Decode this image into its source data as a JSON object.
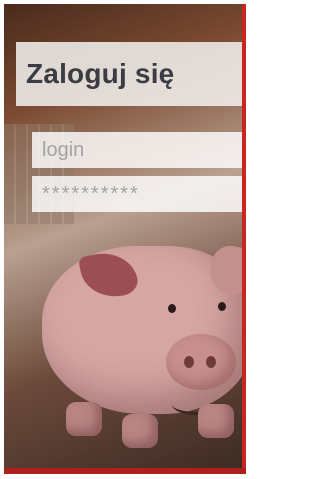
{
  "header": {
    "title": "Zaloguj się"
  },
  "form": {
    "login_placeholder": "login",
    "password_placeholder": "**********"
  },
  "colors": {
    "accent": "#c8261f",
    "title_text": "#3c3c44"
  },
  "illustration": {
    "subject": "piggy-bank"
  }
}
